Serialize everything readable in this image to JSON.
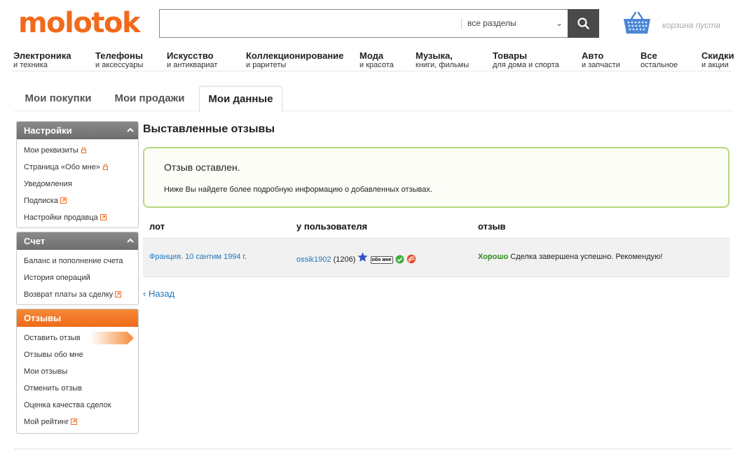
{
  "header": {
    "logo": "molotok",
    "search": {
      "value": "",
      "placeholder": "",
      "category": "все разделы"
    },
    "cart_text": "корзина пуста"
  },
  "nav": [
    {
      "title": "Электроника",
      "sub": "и техника"
    },
    {
      "title": "Телефоны",
      "sub": "и аксессуары"
    },
    {
      "title": "Искусство",
      "sub": "и антиквариат"
    },
    {
      "title": "Коллекционирование",
      "sub": "и раритеты"
    },
    {
      "title": "Мода",
      "sub": "и красота"
    },
    {
      "title": "Музыка,",
      "sub": "книги, фильмы"
    },
    {
      "title": "Товары",
      "sub": "для дома и спорта"
    },
    {
      "title": "Авто",
      "sub": "и запчасти"
    },
    {
      "title": "Все",
      "sub": "остальное"
    },
    {
      "title": "Скидки",
      "sub": "и акции"
    }
  ],
  "tabs": [
    {
      "label": "Мои покупки"
    },
    {
      "label": "Мои продажи"
    },
    {
      "label": "Мои данные",
      "active": true
    }
  ],
  "sidebar": {
    "settings": {
      "title": "Настройки",
      "items": [
        {
          "label": "Мои реквизиты",
          "icon": "lock-icon"
        },
        {
          "label": "Страница «Обо мне»",
          "icon": "lock-icon"
        },
        {
          "label": "Уведомления"
        },
        {
          "label": "Подписка",
          "icon": "external-link-icon"
        },
        {
          "label": "Настройки продавца",
          "icon": "external-link-icon"
        }
      ]
    },
    "account": {
      "title": "Счет",
      "items": [
        {
          "label": "Баланс и пополнение счета"
        },
        {
          "label": "История операций"
        },
        {
          "label": "Возврат платы за сделку",
          "icon": "external-link-icon"
        }
      ]
    },
    "feedback": {
      "title": "Отзывы",
      "items": [
        {
          "label": "Оставить отзыв",
          "active": true
        },
        {
          "label": "Отзывы обо мне"
        },
        {
          "label": "Мои отзывы"
        },
        {
          "label": "Отменить отзыв"
        },
        {
          "label": "Оценка качества сделок"
        },
        {
          "label": "Мой рейтинг",
          "icon": "external-link-icon"
        }
      ]
    }
  },
  "main": {
    "title": "Выставленные отзывы",
    "notice": {
      "title": "Отзыв оставлен.",
      "text": "Ниже Вы найдете более подробную информацию о добавленных отзывах."
    },
    "table": {
      "headers": {
        "lot": "лот",
        "user": "у пользователя",
        "review": "отзыв"
      },
      "rows": [
        {
          "lot": "Франция. 10 сантим 1994 г.",
          "user": "ossik1902",
          "user_score": "(1206)",
          "about_badge": "обо мне",
          "rating": "Хорошо",
          "comment": "Сделка завершена успешно. Рекомендую!"
        }
      ]
    },
    "back_link": "‹ Назад"
  },
  "colors": {
    "brand": "#f26a1b",
    "link": "#2277bb",
    "positive": "#2e8b1f",
    "notice_border": "#b8d67c"
  }
}
